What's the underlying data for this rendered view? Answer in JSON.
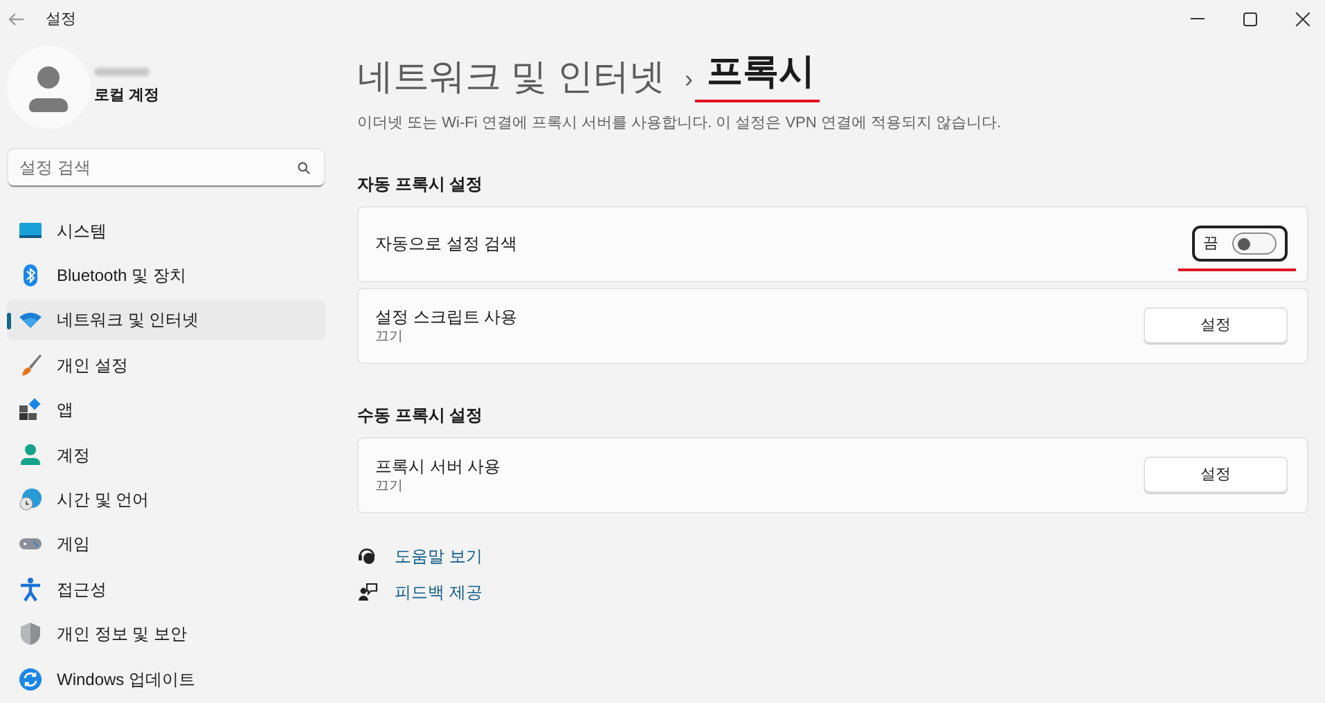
{
  "window": {
    "title": "설정"
  },
  "account": {
    "subtitle": "로컬 계정"
  },
  "search": {
    "placeholder": "설정 검색"
  },
  "sidebar": {
    "items": [
      {
        "label": "시스템",
        "selected": false
      },
      {
        "label": "Bluetooth 및 장치",
        "selected": false
      },
      {
        "label": "네트워크 및 인터넷",
        "selected": true
      },
      {
        "label": "개인 설정",
        "selected": false
      },
      {
        "label": "앱",
        "selected": false
      },
      {
        "label": "계정",
        "selected": false
      },
      {
        "label": "시간 및 언어",
        "selected": false
      },
      {
        "label": "게임",
        "selected": false
      },
      {
        "label": "접근성",
        "selected": false
      },
      {
        "label": "개인 정보 및 보안",
        "selected": false
      },
      {
        "label": "Windows 업데이트",
        "selected": false
      }
    ]
  },
  "breadcrumb": {
    "parent": "네트워크 및 인터넷",
    "separator": "›",
    "current": "프록시",
    "underlined": true
  },
  "description": "이더넷 또는 Wi-Fi 연결에 프록시 서버를 사용합니다. 이 설정은 VPN 연결에 적용되지 않습니다.",
  "sections": [
    {
      "heading": "자동 프록시 설정",
      "cards": [
        {
          "kind": "toggle",
          "title": "자동으로 설정 검색",
          "state_label": "끔",
          "on": false,
          "highlighted": true
        },
        {
          "kind": "button",
          "title": "설정 스크립트 사용",
          "subtitle": "끄기",
          "button": "설정"
        }
      ]
    },
    {
      "heading": "수동 프록시 설정",
      "cards": [
        {
          "kind": "button",
          "title": "프록시 서버 사용",
          "subtitle": "끄기",
          "button": "설정"
        }
      ]
    }
  ],
  "links": [
    {
      "label": "도움말 보기"
    },
    {
      "label": "피드백 제공"
    }
  ]
}
